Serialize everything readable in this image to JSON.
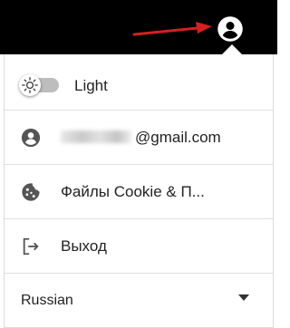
{
  "colors": {
    "topbar": "#000000",
    "arrow": "#d32020",
    "icon": "#555555",
    "text": "#222222",
    "divider": "#e0e0e0"
  },
  "header": {
    "account_icon": "account-circle-icon",
    "annotation": "red-arrow-pointing-to-account-icon"
  },
  "menu": {
    "theme": {
      "label": "Light",
      "icon": "sun-icon",
      "toggle_state": "off"
    },
    "account": {
      "icon": "account-circle-icon",
      "email_visible": "@gmail.com",
      "email_redacted": true
    },
    "cookies": {
      "icon": "cookie-icon",
      "label": "Файлы Cookie & П..."
    },
    "logout": {
      "icon": "logout-icon",
      "label": "Выход"
    },
    "language": {
      "selected": "Russian",
      "icon": "caret-down-icon"
    }
  }
}
